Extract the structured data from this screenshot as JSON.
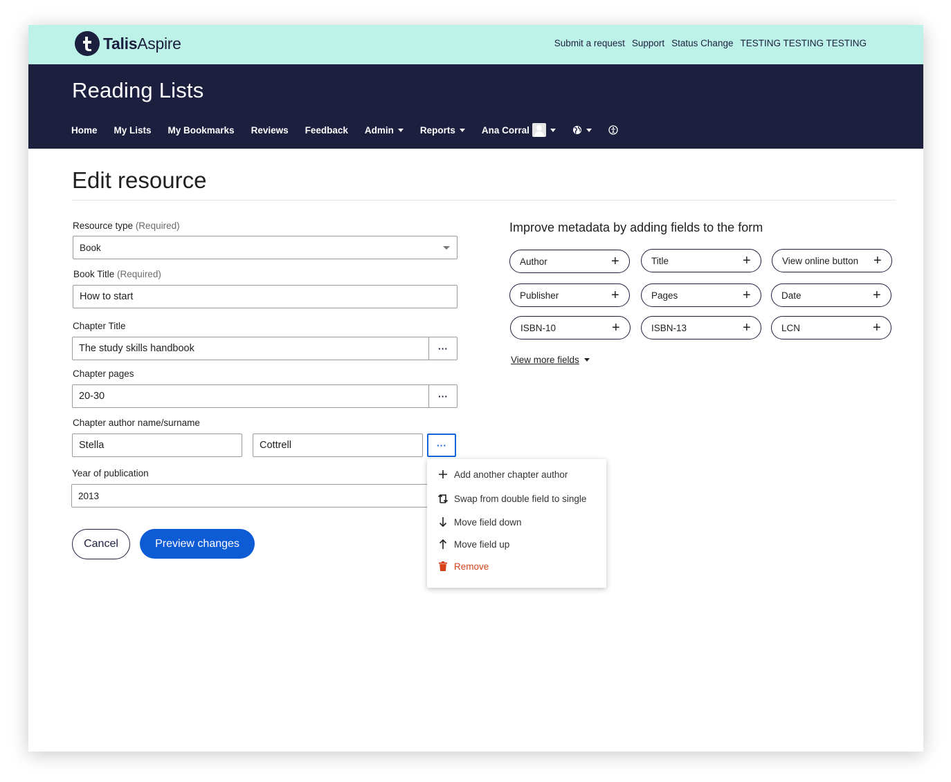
{
  "brand": {
    "name_bold": "Talis",
    "name_regular": "Aspire"
  },
  "top_links": [
    "Submit a request",
    "Support",
    "Status Change",
    "TESTING TESTING TESTING"
  ],
  "app_title": "Reading Lists",
  "nav": {
    "home": "Home",
    "my_lists": "My Lists",
    "my_bookmarks": "My Bookmarks",
    "reviews": "Reviews",
    "feedback": "Feedback",
    "admin": "Admin",
    "reports": "Reports",
    "user": "Ana Corral"
  },
  "page_title": "Edit resource",
  "form": {
    "resource_type": {
      "label": "Resource type",
      "required": "(Required)",
      "value": "Book"
    },
    "book_title": {
      "label": "Book Title",
      "required": "(Required)",
      "value": "How to start"
    },
    "chapter_title": {
      "label": "Chapter Title",
      "value": "The study skills handbook"
    },
    "chapter_pages": {
      "label": "Chapter pages",
      "value": "20-30"
    },
    "chapter_author": {
      "label": "Chapter author name/surname",
      "first": "Stella",
      "last": "Cottrell"
    },
    "year": {
      "label": "Year of publication",
      "value": "2013"
    },
    "more_glyph": "···"
  },
  "actions": {
    "cancel": "Cancel",
    "preview": "Preview changes"
  },
  "metadata": {
    "heading": "Improve metadata by adding fields to the form",
    "fields": [
      "Author",
      "Title",
      "View online button",
      "Publisher",
      "Pages",
      "Date",
      "ISBN-10",
      "ISBN-13",
      "LCN"
    ],
    "plus": "+",
    "view_more": "View more fields"
  },
  "menu": {
    "items": [
      {
        "label": "Add another chapter author",
        "icon": "plus-icon"
      },
      {
        "label": "Swap from double field to single",
        "icon": "swap-icon"
      },
      {
        "label": "Move field down",
        "icon": "arrow-down-icon"
      },
      {
        "label": "Move field  up",
        "icon": "arrow-up-icon"
      },
      {
        "label": "Remove",
        "icon": "trash-icon"
      }
    ],
    "danger_color": "#d4421c"
  },
  "colors": {
    "teal": "#bcf2e8",
    "navy": "#1d1f3f",
    "primary": "#0e5bd6"
  }
}
